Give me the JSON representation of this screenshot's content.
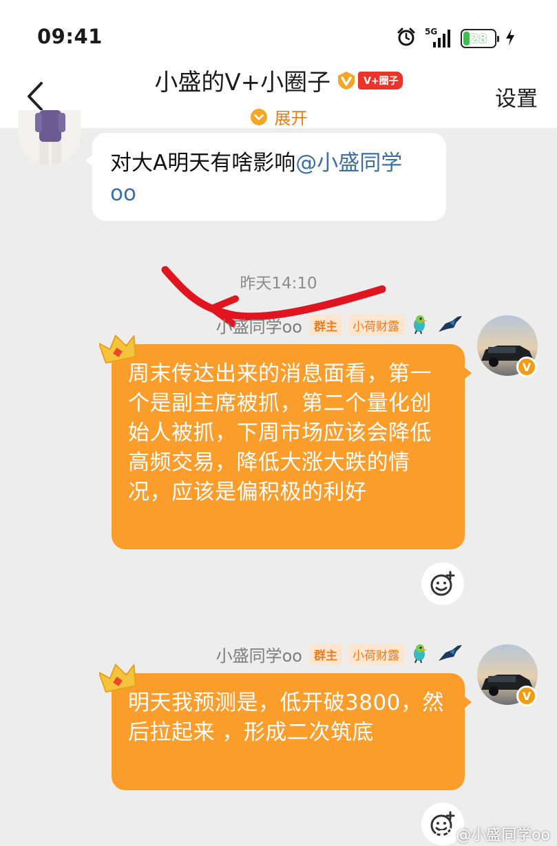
{
  "status_bar": {
    "time": "09:41",
    "network": "5G",
    "battery": "28",
    "battery_fraction": 0.28,
    "icons": [
      "alarm-icon",
      "signal-icon",
      "battery-icon",
      "charging-icon"
    ]
  },
  "header": {
    "title": "小盛的V+小圈子",
    "badge_label": "V+圈子",
    "expand_label": "展开",
    "settings_label": "设置",
    "back_icon": "chevron-left-icon"
  },
  "messages": [
    {
      "sender": "other",
      "text": "对大A明天有啥影响",
      "mention": "@小盛同学oo"
    },
    {
      "sender": "owner",
      "timestamp": "昨天14:10",
      "name": "小盛同学oo",
      "role_tag": "群主",
      "rank_tag": "小荷财露",
      "text": "周末传达出来的消息面看，第一个是副主席被抓，第二个量化创始人被抓，下周市场应该会降低高频交易，降低大涨大跌的情况，应该是偏积极的利好"
    },
    {
      "sender": "owner",
      "name": "小盛同学oo",
      "role_tag": "群主",
      "rank_tag": "小荷财露",
      "text": "明天我预测是，低开破3800，然后拉起来 ，形成二次筑底"
    }
  ],
  "watermark": "@小盛同学oo",
  "colors": {
    "accent_orange": "#fb9d2b",
    "badge_red": "#e8352b",
    "mention_blue": "#3d6fa7",
    "annotation_red": "#e0151f"
  }
}
